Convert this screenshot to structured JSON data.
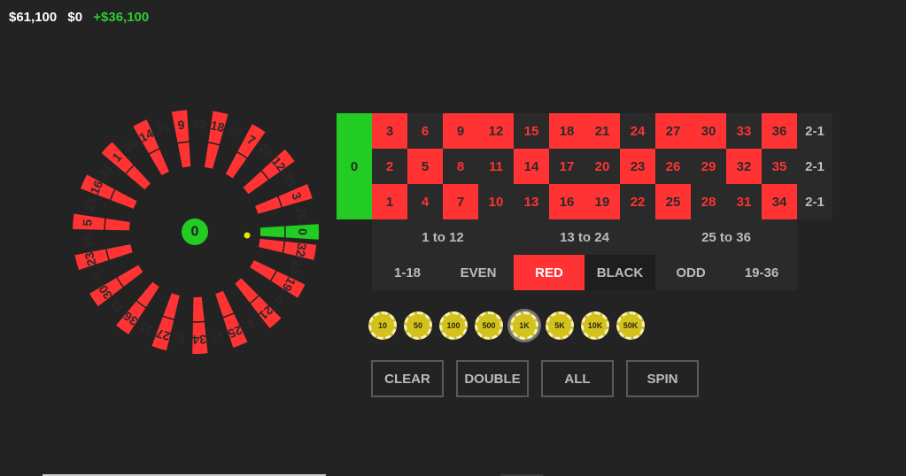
{
  "stats": {
    "balance": "$61,100",
    "bet": "$0",
    "profit": "+$36,100"
  },
  "wheel": {
    "numbers": [
      0,
      32,
      15,
      19,
      4,
      21,
      2,
      25,
      17,
      34,
      6,
      27,
      13,
      36,
      11,
      30,
      8,
      23,
      10,
      5,
      24,
      16,
      33,
      1,
      20,
      14,
      31,
      9,
      22,
      18,
      29,
      7,
      28,
      12,
      35,
      3,
      26
    ],
    "result": "0",
    "result_number": 0,
    "colors": {
      "red": "#ff3333",
      "green": "#22cc22",
      "dark": "#232323",
      "ball": "#e6e600"
    }
  },
  "board": {
    "zero": "0",
    "rows": [
      [
        "3",
        "6",
        "9",
        "12",
        "15",
        "18",
        "21",
        "24",
        "27",
        "30",
        "33",
        "36"
      ],
      [
        "2",
        "5",
        "8",
        "11",
        "14",
        "17",
        "20",
        "23",
        "26",
        "29",
        "32",
        "35"
      ],
      [
        "1",
        "4",
        "7",
        "10",
        "13",
        "16",
        "19",
        "22",
        "25",
        "28",
        "31",
        "34"
      ]
    ],
    "red_numbers": [
      1,
      3,
      5,
      7,
      9,
      12,
      14,
      16,
      18,
      19,
      21,
      23,
      25,
      27,
      30,
      32,
      34,
      36
    ],
    "column_label": "2-1",
    "dozens": [
      "1 to 12",
      "13 to 24",
      "25 to 36"
    ],
    "outside": [
      "1-18",
      "EVEN",
      "RED",
      "BLACK",
      "ODD",
      "19-36"
    ]
  },
  "chips": [
    "10",
    "50",
    "100",
    "500",
    "1K",
    "5K",
    "10K",
    "50K"
  ],
  "selected_chip": "1K",
  "buttons": {
    "clear": "CLEAR",
    "double": "DOUBLE",
    "all": "ALL",
    "spin": "SPIN"
  }
}
